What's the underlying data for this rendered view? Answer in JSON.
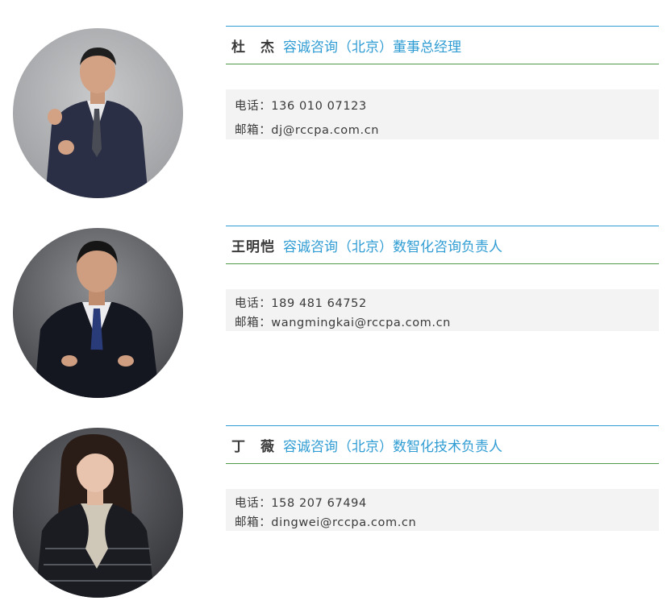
{
  "people": [
    {
      "name": "杜　杰",
      "title": "容诚咨询（北京）董事总经理",
      "phone": "电话：136 010 07123",
      "email": "邮箱：dj@rccpa.com.cn"
    },
    {
      "name": "王明恺",
      "title": "容诚咨询（北京）数智化咨询负责人",
      "phone": "电话：189 481 64752",
      "email": "邮箱：wangmingkai@rccpa.com.cn"
    },
    {
      "name": "丁　薇",
      "title": "容诚咨询（北京）数智化技术负责人",
      "phone": "电话：158 207 67494",
      "email": "邮箱：dingwei@rccpa.com.cn"
    }
  ]
}
